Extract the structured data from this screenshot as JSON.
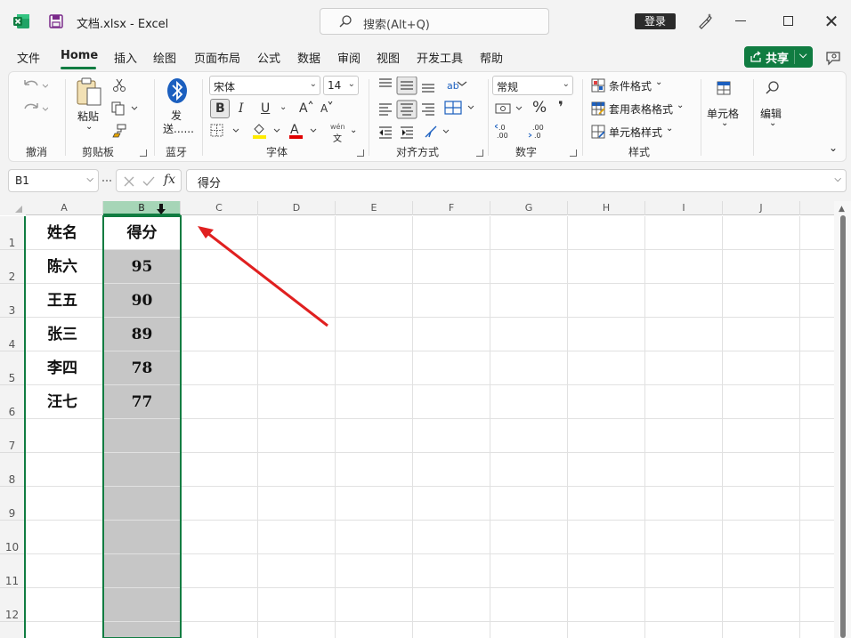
{
  "titlebar": {
    "doc_title": "文档.xlsx  -  Excel",
    "search_placeholder": "搜索(Alt+Q)",
    "login_label": "登录",
    "close_glyph": "✕"
  },
  "tabs": [
    "文件",
    "Home",
    "插入",
    "绘图",
    "页面布局",
    "公式",
    "数据",
    "审阅",
    "视图",
    "开发工具",
    "帮助"
  ],
  "share": {
    "label": "共享",
    "chevron": "⌵"
  },
  "ribbon": {
    "groups": {
      "undo": "撤消",
      "clipboard": "剪贴板",
      "bluetooth": "蓝牙",
      "font": "字体",
      "align": "对齐方式",
      "number": "数字",
      "styles": "样式"
    },
    "paste_label": "粘贴",
    "send_label_1": "发",
    "send_label_2": "送......",
    "font_name": "宋体",
    "font_size": "14",
    "bold": "B",
    "italic": "I",
    "underline": "U",
    "number_format": "常规",
    "conditional_format": "条件格式",
    "table_format": "套用表格格式",
    "cell_style": "单元格样式",
    "cells_label": "单元格",
    "edit_label": "编辑",
    "percent": "%",
    "comma": "❜",
    "dropdown_glyph": "⌄",
    "wen_top": "wén",
    "wen_bottom": "文"
  },
  "formula_bar": {
    "name_box": "B1",
    "formula_value": "得分",
    "fx": "fx",
    "dropdown_glyph": "⌵"
  },
  "sheet": {
    "columns": [
      "A",
      "B",
      "C",
      "D",
      "E",
      "F",
      "G",
      "H",
      "I",
      "J"
    ],
    "rows": [
      "1",
      "2",
      "3",
      "4",
      "5",
      "6",
      "7",
      "8",
      "9",
      "10",
      "11",
      "12"
    ],
    "header": {
      "name": "姓名",
      "score": "得分"
    },
    "data": [
      {
        "name": "陈六",
        "score": "95"
      },
      {
        "name": "王五",
        "score": "90"
      },
      {
        "name": "张三",
        "score": "89"
      },
      {
        "name": "李四",
        "score": "78"
      },
      {
        "name": "汪七",
        "score": "77"
      }
    ],
    "selected_column": "B"
  },
  "colors": {
    "accent": "#107c41",
    "selection_fill": "#c6c6c6",
    "annotation_arrow": "#e02020"
  }
}
